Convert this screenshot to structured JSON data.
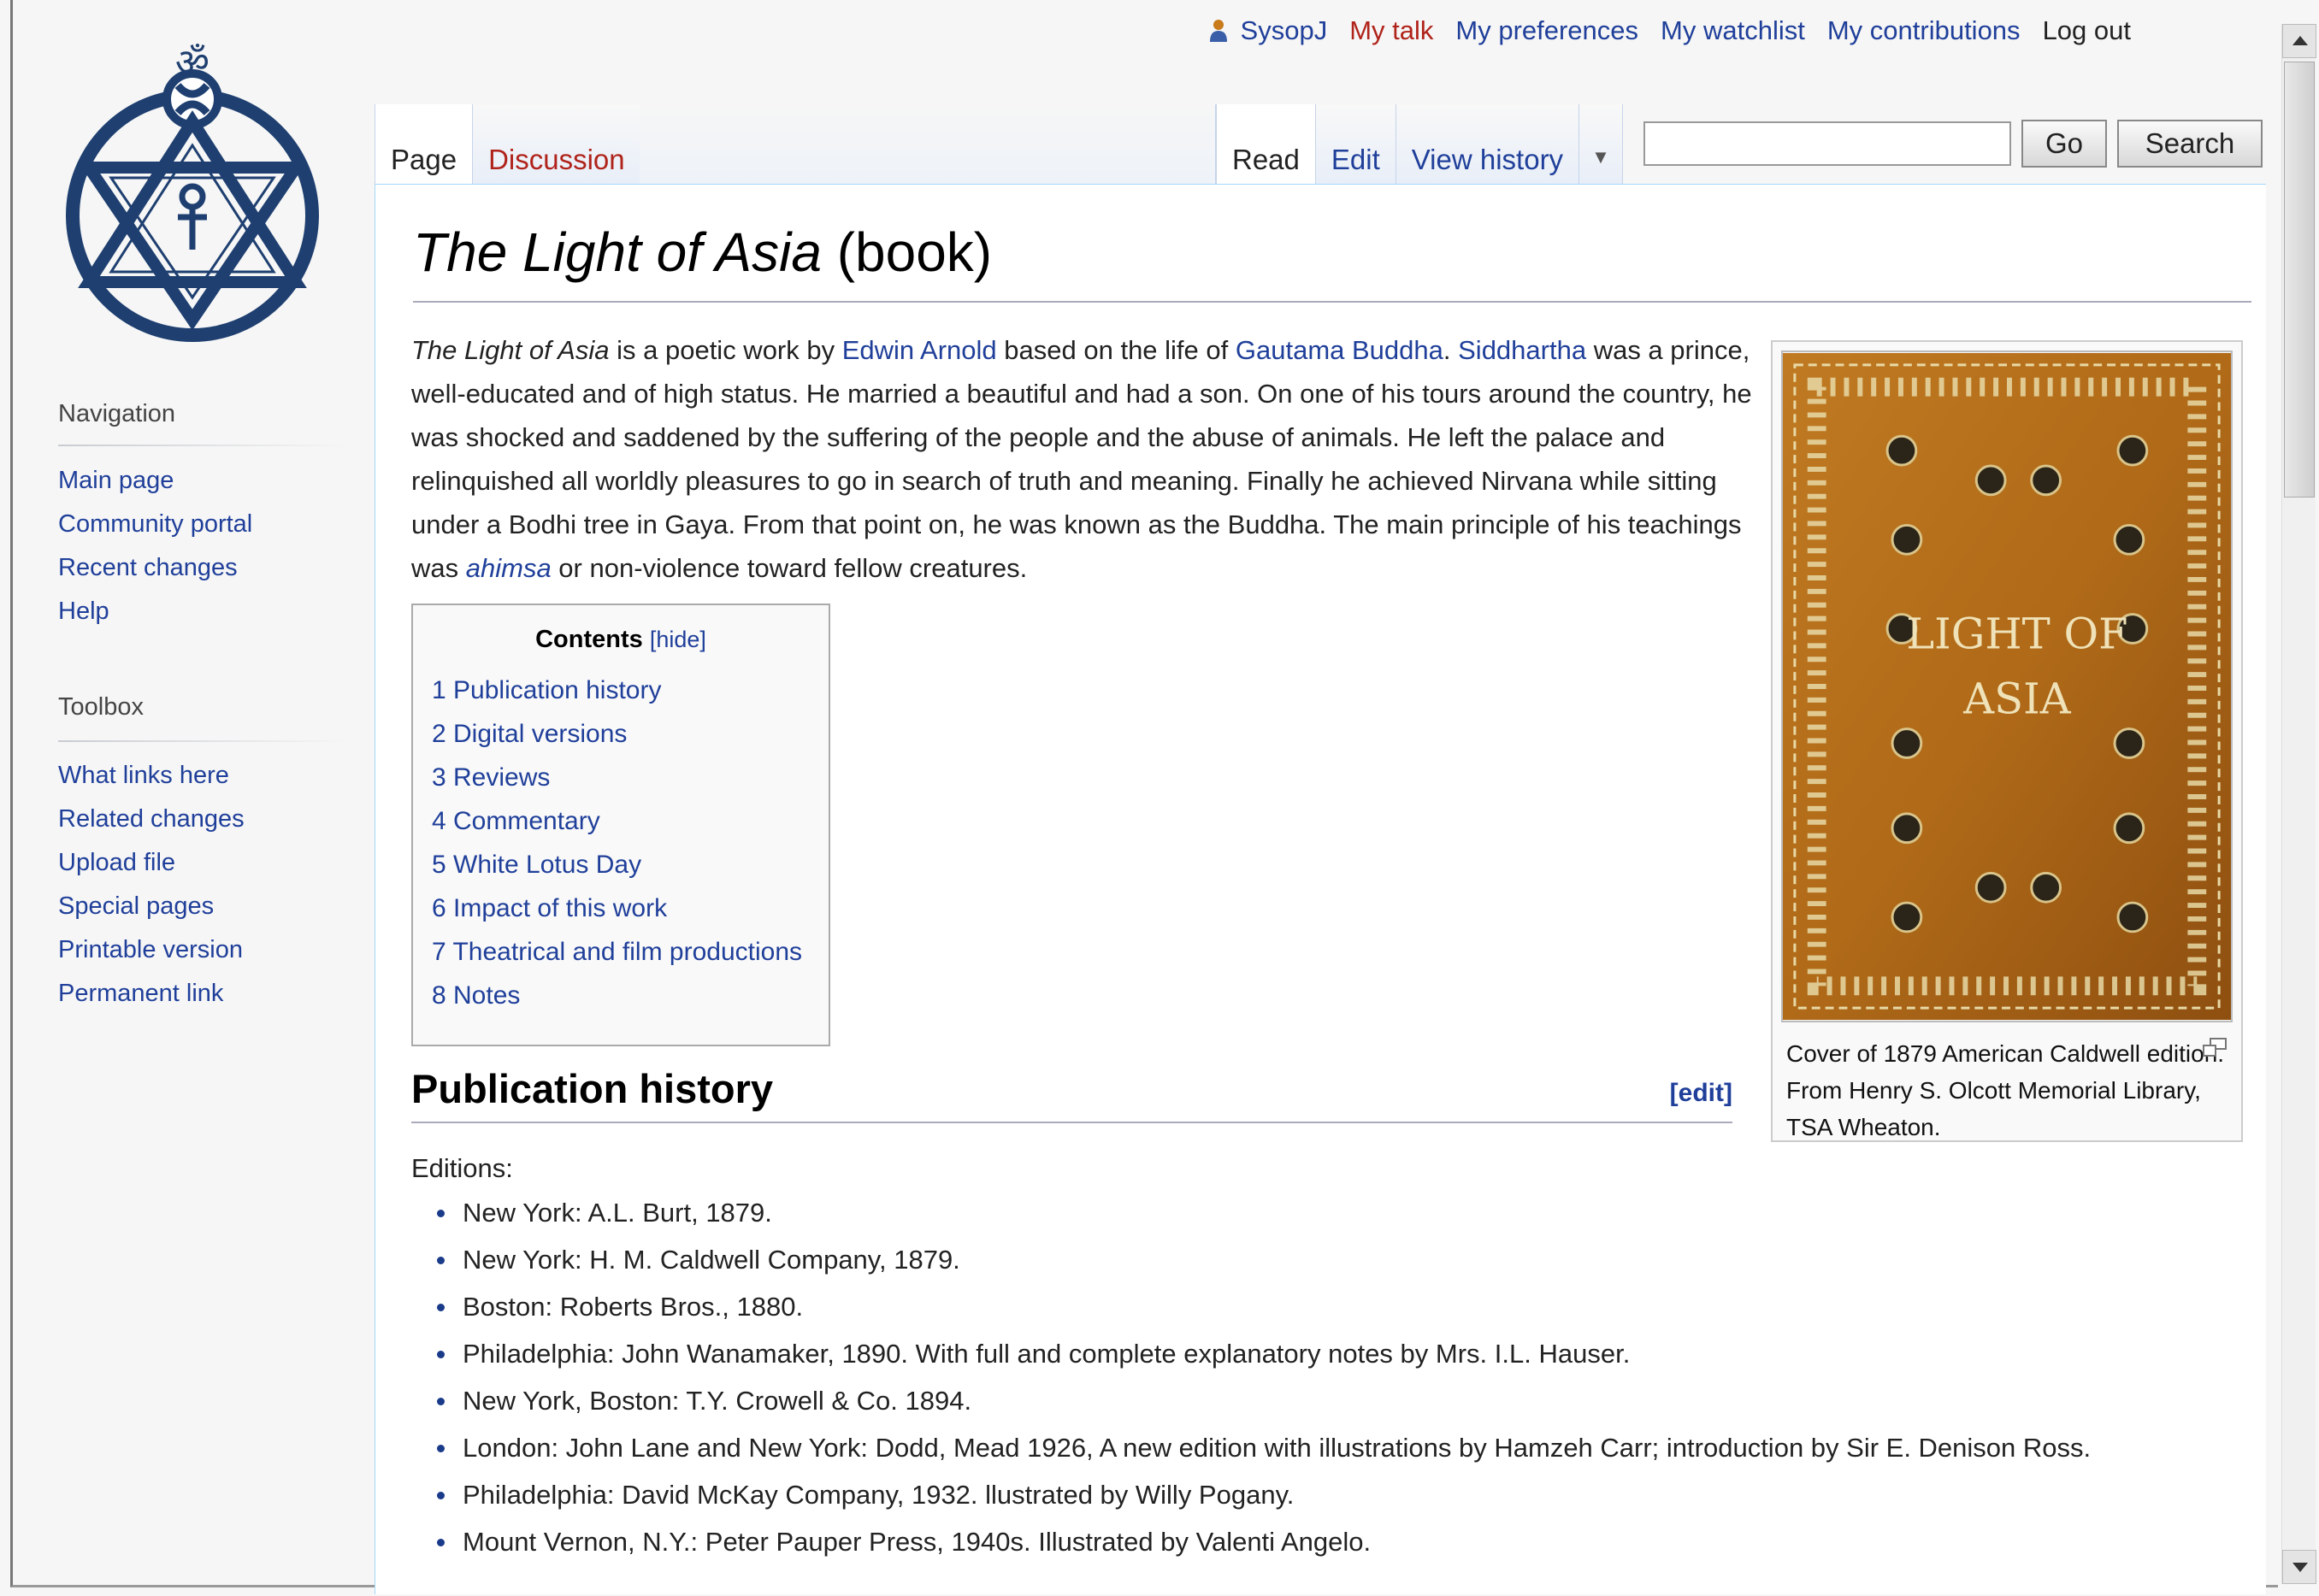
{
  "personal": {
    "username": "SysopJ",
    "talk": "My talk",
    "preferences": "My preferences",
    "watchlist": "My watchlist",
    "contributions": "My contributions",
    "logout": "Log out"
  },
  "tabs": {
    "page": "Page",
    "discussion": "Discussion",
    "read": "Read",
    "edit": "Edit",
    "history": "View history"
  },
  "search": {
    "value": "",
    "go": "Go",
    "search": "Search"
  },
  "logo": {
    "glyph": "ॐ"
  },
  "sidebar": {
    "navigation": {
      "heading": "Navigation",
      "items": [
        "Main page",
        "Community portal",
        "Recent changes",
        "Help"
      ]
    },
    "toolbox": {
      "heading": "Toolbox",
      "items": [
        "What links here",
        "Related changes",
        "Upload file",
        "Special pages",
        "Printable version",
        "Permanent link"
      ]
    }
  },
  "article": {
    "title_italic": "The Light of Asia",
    "title_rest": " (book)",
    "intro": {
      "title_italic": "The Light of Asia",
      "t1": " is a poetic work by ",
      "link_arnold": "Edwin Arnold",
      "t2": " based on the life of ",
      "link_buddha": "Gautama Buddha",
      "t3": ". ",
      "link_siddhartha": "Siddhartha",
      "t4": " was a prince, well-educated and of high status. He married a beautiful and had a son. On one of his tours around the country, he was shocked and saddened by the suffering of the people and the abuse of animals. He left the palace and relinquished all worldly pleasures to go in search of truth and meaning. Finally he achieved Nirvana while sitting under a Bodhi tree in Gaya. From that point on, he was known as the Buddha. The main principle of his teachings was ",
      "link_ahimsa": "ahimsa",
      "t5": " or non-violence toward fellow creatures."
    },
    "toc": {
      "title": "Contents",
      "hide": "[hide]",
      "items": [
        "1 Publication history",
        "2 Digital versions",
        "3 Reviews",
        "4 Commentary",
        "5 White Lotus Day",
        "6 Impact of this work",
        "7 Theatrical and film productions",
        "8 Notes"
      ]
    },
    "section_heading": "Publication history",
    "section_edit": "[edit]",
    "editions_label": "Editions:",
    "editions": [
      "New York: A.L. Burt, 1879.",
      "New York: H. M. Caldwell Company, 1879.",
      "Boston: Roberts Bros., 1880.",
      "Philadelphia: John Wanamaker, 1890. With full and complete explanatory notes by Mrs. I.L. Hauser.",
      "New York, Boston: T.Y. Crowell & Co. 1894.",
      "London: John Lane and New York: Dodd, Mead 1926, A new edition with illustrations by Hamzeh Carr; introduction by Sir E. Denison Ross.",
      "Philadelphia: David McKay Company, 1932. llustrated by Willy Pogany.",
      "Mount Vernon, N.Y.: Peter Pauper Press, 1940s. Illustrated by Valenti Angelo."
    ],
    "thumb": {
      "cover_line1": "LIGHT OF",
      "cover_line2": "ASIA",
      "caption": "Cover of 1879 American Caldwell edition. From Henry S. Olcott Memorial Library, TSA Wheaton."
    }
  },
  "colors": {
    "link": "#1f3f9a",
    "new_link": "#b0231a",
    "logo_blue": "#1e3f70",
    "cover_brown": "#b8741e"
  }
}
